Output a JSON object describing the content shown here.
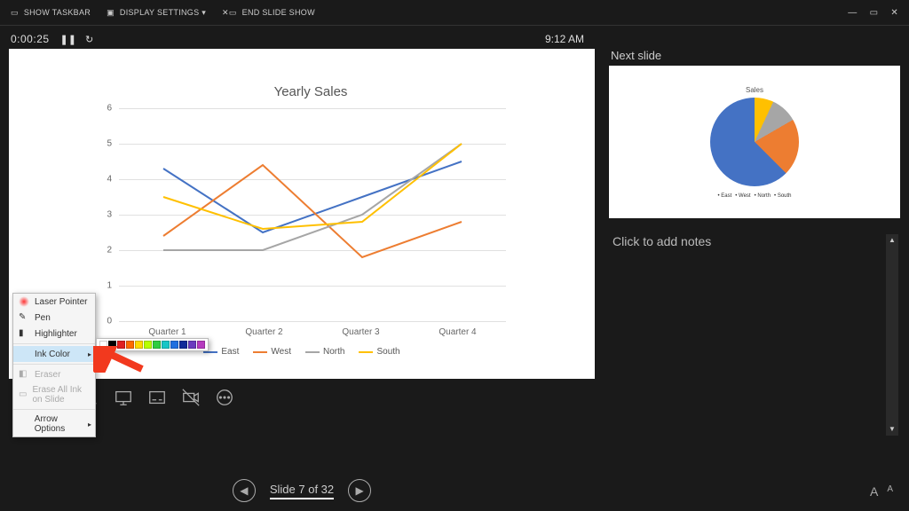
{
  "toolbar": {
    "show_taskbar": "SHOW TASKBAR",
    "display_settings": "DISPLAY SETTINGS ▾",
    "end_slideshow": "END SLIDE SHOW"
  },
  "timer": {
    "elapsed": "0:00:25",
    "clock": "9:12 AM"
  },
  "main_slide": {
    "chart_title": "Yearly Sales"
  },
  "chart_data": {
    "type": "line",
    "title": "Yearly Sales",
    "categories": [
      "Quarter 1",
      "Quarter 2",
      "Quarter 3",
      "Quarter 4"
    ],
    "ylim": [
      0,
      6
    ],
    "yticks": [
      0,
      1,
      2,
      3,
      4,
      5,
      6
    ],
    "series": [
      {
        "name": "East",
        "color": "#4472c4",
        "values": [
          4.3,
          2.5,
          3.5,
          4.5
        ]
      },
      {
        "name": "West",
        "color": "#ed7d31",
        "values": [
          2.4,
          4.4,
          1.8,
          2.8
        ]
      },
      {
        "name": "North",
        "color": "#a6a6a6",
        "values": [
          2.0,
          2.0,
          3.0,
          5.0
        ]
      },
      {
        "name": "South",
        "color": "#ffc000",
        "values": [
          3.5,
          2.6,
          2.8,
          5.0
        ]
      }
    ]
  },
  "next": {
    "label": "Next slide",
    "pie_title": "Sales",
    "pie_legend": [
      "East",
      "West",
      "North",
      "South"
    ]
  },
  "notes": {
    "placeholder": "Click to add notes"
  },
  "footer": {
    "slide_counter": "Slide 7 of 32"
  },
  "font": {
    "bigger": "A",
    "smaller": "A"
  },
  "popup": {
    "laser_pointer": "Laser Pointer",
    "pen": "Pen",
    "highlighter": "Highlighter",
    "ink_color": "Ink Color",
    "eraser": "Eraser",
    "erase_all": "Erase All Ink on Slide",
    "arrow_options": "Arrow Options"
  },
  "color_palette": [
    "#ffffff",
    "#000000",
    "#e02020",
    "#ff6a00",
    "#ffd900",
    "#b8ff00",
    "#2ecc40",
    "#17c6c6",
    "#1f6fe0",
    "#112a99",
    "#6a3abf",
    "#b63abf"
  ]
}
